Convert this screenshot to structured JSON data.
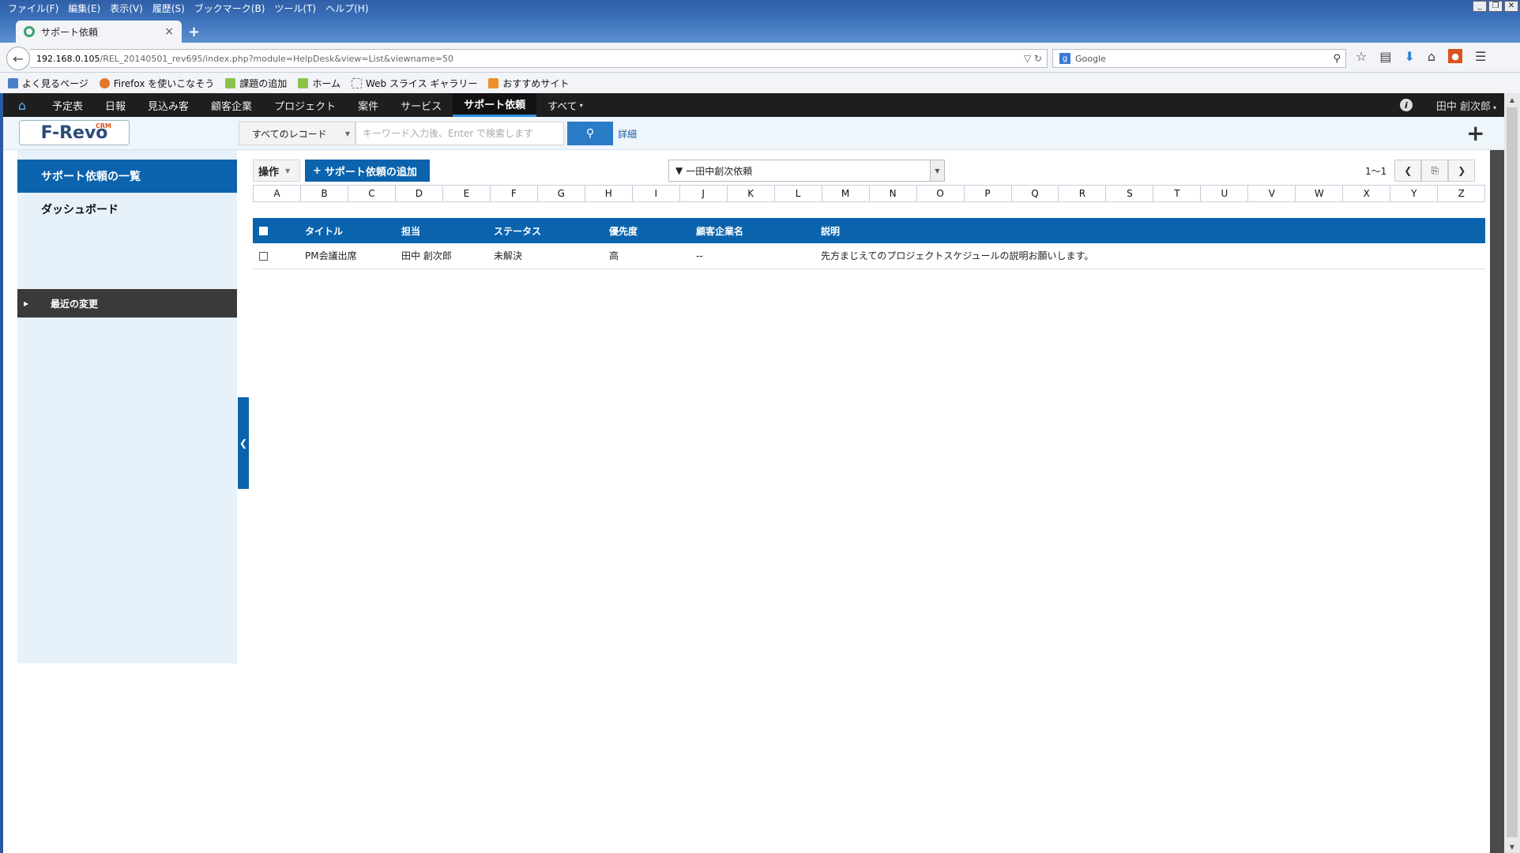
{
  "browser": {
    "menu": [
      "ファイル(F)",
      "編集(E)",
      "表示(V)",
      "履歴(S)",
      "ブックマーク(B)",
      "ツール(T)",
      "ヘルプ(H)"
    ],
    "tab_title": "サポート依頼",
    "url_host": "192.168.0.105",
    "url_path": "/REL_20140501_rev695/index.php?module=HelpDesk&view=List&viewname=50",
    "search_engine": "Google",
    "bookmarks": [
      "よく見るページ",
      "Firefox を使いこなそう",
      "課題の追加",
      "ホーム",
      "Web スライス ギャラリー",
      "おすすめサイト"
    ]
  },
  "app": {
    "nav": [
      "予定表",
      "日報",
      "見込み客",
      "顧客企業",
      "プロジェクト",
      "案件",
      "サービス",
      "サポート依頼",
      "すべて"
    ],
    "active_nav": "サポート依頼",
    "user": "田中 創次郎",
    "logo": "F-Revo",
    "logo_tag": "CRM",
    "search": {
      "record_select": "すべてのレコード",
      "placeholder": "キーワード入力後、Enter で検索します",
      "detail_link": "詳細"
    },
    "sidebar": {
      "items": [
        "サポート依頼の一覧",
        "ダッシュボード"
      ],
      "recent": "最近の変更"
    },
    "toolbar": {
      "ops_label": "操作",
      "add_label": "サポート依頼の追加",
      "filter_label": "一田中創次依頼",
      "page_range": "1～1"
    },
    "alphabet": [
      "A",
      "B",
      "C",
      "D",
      "E",
      "F",
      "G",
      "H",
      "I",
      "J",
      "K",
      "L",
      "M",
      "N",
      "O",
      "P",
      "Q",
      "R",
      "S",
      "T",
      "U",
      "V",
      "W",
      "X",
      "Y",
      "Z"
    ],
    "table": {
      "headers": [
        "タイトル",
        "担当",
        "ステータス",
        "優先度",
        "顧客企業名",
        "説明"
      ],
      "rows": [
        [
          "PM会議出席",
          "田中 創次郎",
          "未解決",
          "高",
          "--",
          "先方まじえてのプロジェクトスケジュールの説明お願いします。"
        ]
      ]
    }
  },
  "colors": {
    "accent": "#0b63ad",
    "topnav": "#1e1e1e",
    "sidebar": "#e6f1fa"
  }
}
